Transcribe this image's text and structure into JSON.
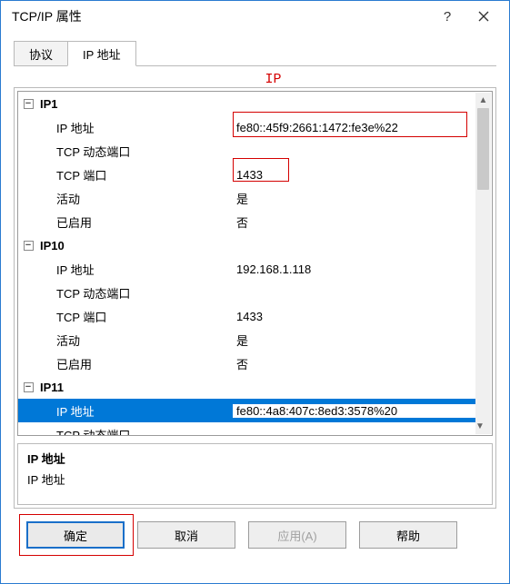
{
  "window": {
    "title": "TCP/IP 属性"
  },
  "titlebar": {
    "help": "?",
    "close": "✕"
  },
  "tabs": {
    "protocol": "协议",
    "ip": "IP 地址"
  },
  "annotation": {
    "ip": "IP"
  },
  "groups": {
    "ip1": {
      "header": "IP1",
      "rows": {
        "addr_label": "IP 地址",
        "addr_value": "fe80::45f9:2661:1472:fe3e%22",
        "dynport_label": "TCP 动态端口",
        "dynport_value": "",
        "port_label": "TCP 端口",
        "port_value": "1433",
        "active_label": "活动",
        "active_value": "是",
        "enabled_label": "已启用",
        "enabled_value": "否"
      }
    },
    "ip10": {
      "header": "IP10",
      "rows": {
        "addr_label": "IP 地址",
        "addr_value": "192.168.1.118",
        "dynport_label": "TCP 动态端口",
        "dynport_value": "",
        "port_label": "TCP 端口",
        "port_value": "1433",
        "active_label": "活动",
        "active_value": "是",
        "enabled_label": "已启用",
        "enabled_value": "否"
      }
    },
    "ip11": {
      "header": "IP11",
      "rows": {
        "addr_label": "IP 地址",
        "addr_value": "fe80::4a8:407c:8ed3:3578%20",
        "dynport_label": "TCP 动态端口",
        "dynport_value": ""
      }
    }
  },
  "description": {
    "title": "IP 地址",
    "body": "IP 地址"
  },
  "buttons": {
    "ok": "确定",
    "cancel": "取消",
    "apply": "应用(A)",
    "help": "帮助"
  },
  "icons": {
    "collapse": "−",
    "up": "▲",
    "down": "▼"
  }
}
